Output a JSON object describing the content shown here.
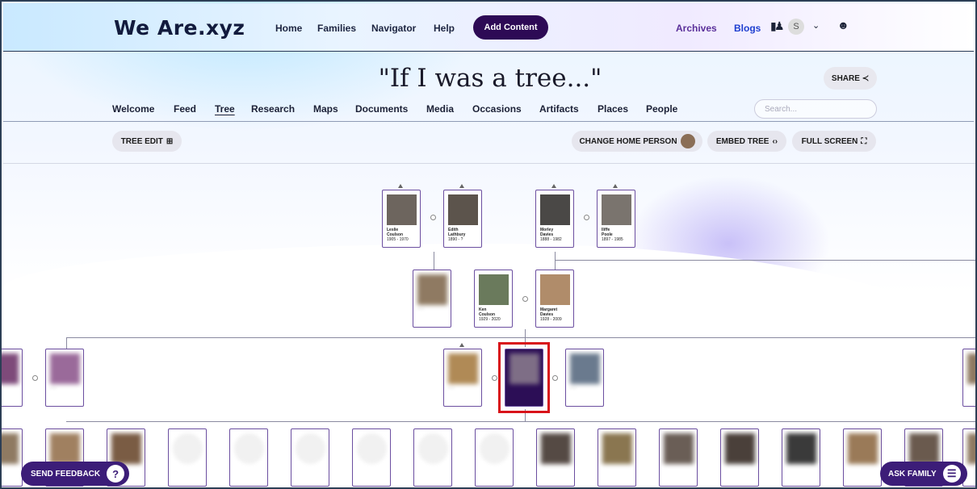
{
  "brand": "We Are.xyz",
  "nav": [
    "Home",
    "Families",
    "Navigator",
    "Help"
  ],
  "add_content": "Add Content",
  "right_nav": [
    "Archives",
    "Blogs"
  ],
  "avatar_initial": "S",
  "page_title": "\"If I was a tree...\"",
  "share": "SHARE",
  "tabs": [
    "Welcome",
    "Feed",
    "Tree",
    "Research",
    "Maps",
    "Documents",
    "Media",
    "Occasions",
    "Artifacts",
    "Places",
    "People"
  ],
  "active_tab": "Tree",
  "search_placeholder": "Search...",
  "toolbar": {
    "tree_edit": "TREE EDIT",
    "change_home": "CHANGE HOME PERSON",
    "embed": "EMBED TREE",
    "fullscreen": "FULL SCREEN"
  },
  "people": {
    "leslie": {
      "first": "Leslie",
      "last": "Coulson",
      "years": "1905 - 1970"
    },
    "edith": {
      "first": "Edith",
      "last": "Lathbury",
      "years": "1890 - ?"
    },
    "morley": {
      "first": "Morley",
      "last": "Davies",
      "years": "1888 - 1982"
    },
    "iliffe": {
      "first": "Iliffe",
      "last": "Poole",
      "years": "1897 - 1985"
    },
    "ken": {
      "first": "Ken",
      "last": "Coulson",
      "years": "1929 - 2020"
    },
    "margaret": {
      "first": "Margaret",
      "last": "Davies",
      "years": "1928 - 2009"
    }
  },
  "send_feedback": "SEND FEEDBACK",
  "ask_family": "ASK FAMILY",
  "colors": {
    "brand_dark": "#2d0a55",
    "highlight": "#d8131a"
  }
}
